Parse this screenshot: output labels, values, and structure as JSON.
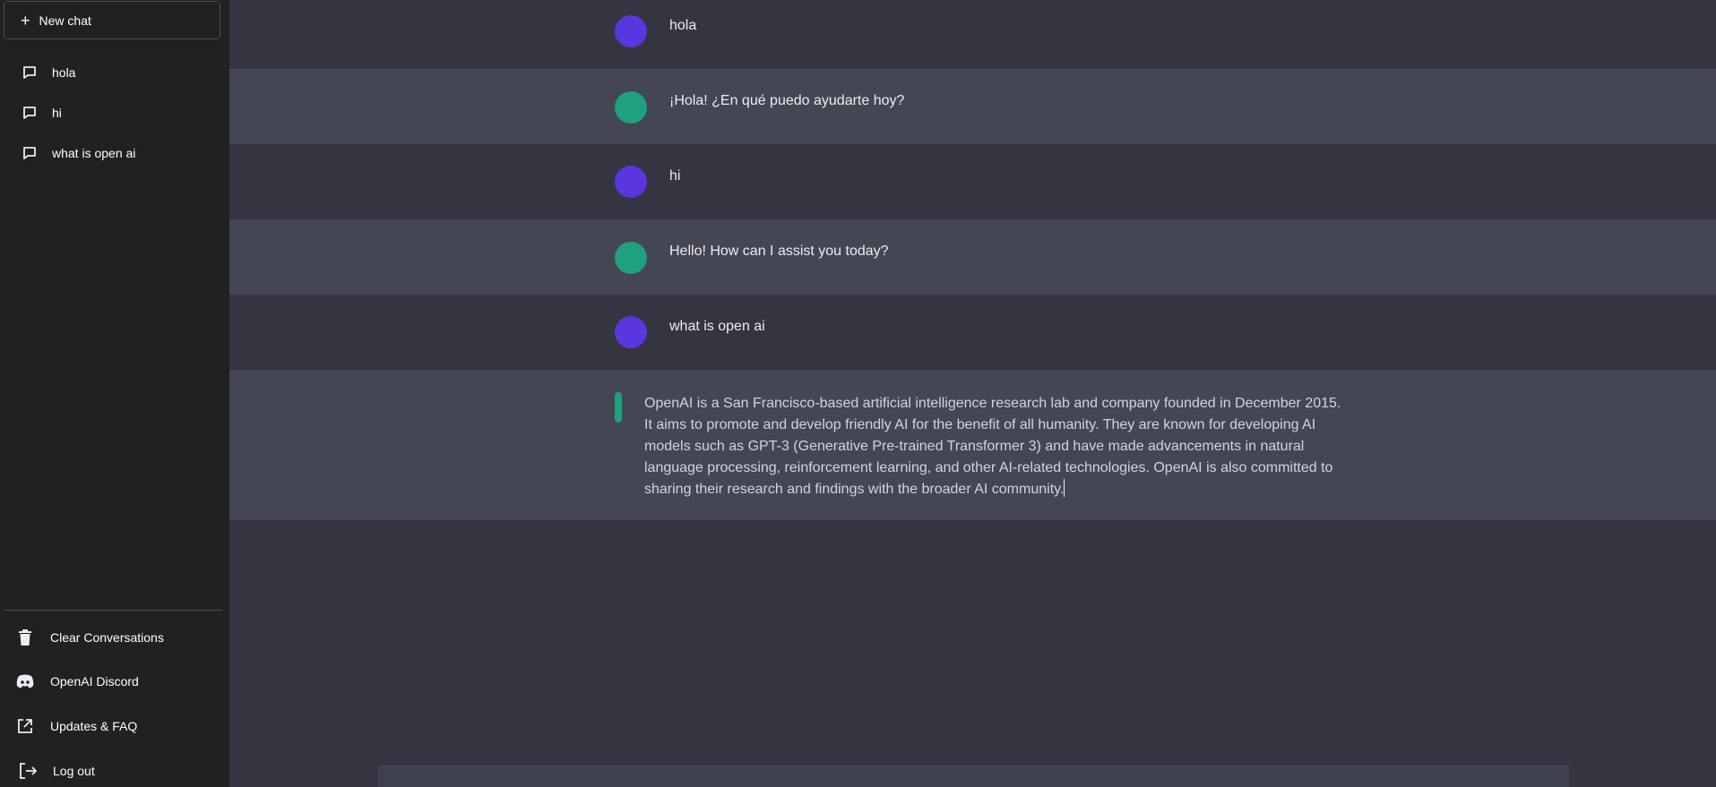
{
  "sidebar": {
    "new_chat_label": "New chat",
    "chats": [
      {
        "label": "hola"
      },
      {
        "label": "hi"
      },
      {
        "label": "what is open ai"
      }
    ],
    "bottom": {
      "clear": "Clear Conversations",
      "discord": "OpenAI Discord",
      "updates": "Updates & FAQ",
      "logout": "Log out"
    }
  },
  "messages": [
    {
      "role": "user",
      "text": "hola"
    },
    {
      "role": "assistant",
      "text": "¡Hola! ¿En qué puedo ayudarte hoy?"
    },
    {
      "role": "user",
      "text": "hi"
    },
    {
      "role": "assistant",
      "text": "Hello! How can I assist you today?"
    },
    {
      "role": "user",
      "text": "what is open ai"
    },
    {
      "role": "assistant",
      "text": "OpenAI is a San Francisco-based artificial intelligence research lab and company founded in December 2015. It aims to promote and develop friendly AI for the benefit of all humanity. They are known for developing AI models such as GPT-3 (Generative Pre-trained Transformer 3) and have made advancements in natural language processing, reinforcement learning, and other AI-related technologies. OpenAI is also committed to sharing their research and findings with the broader AI community."
    }
  ],
  "colors": {
    "sidebar_bg": "#202123",
    "main_bg": "#343541",
    "assistant_row_bg": "#444654",
    "user_avatar": "#5a36df",
    "assistant_avatar": "#1fa07f"
  },
  "icons": {
    "new_chat": "plus-icon",
    "chat": "message-icon",
    "clear": "trash-icon",
    "discord": "discord-icon",
    "updates": "external-link-icon",
    "logout": "logout-icon"
  }
}
